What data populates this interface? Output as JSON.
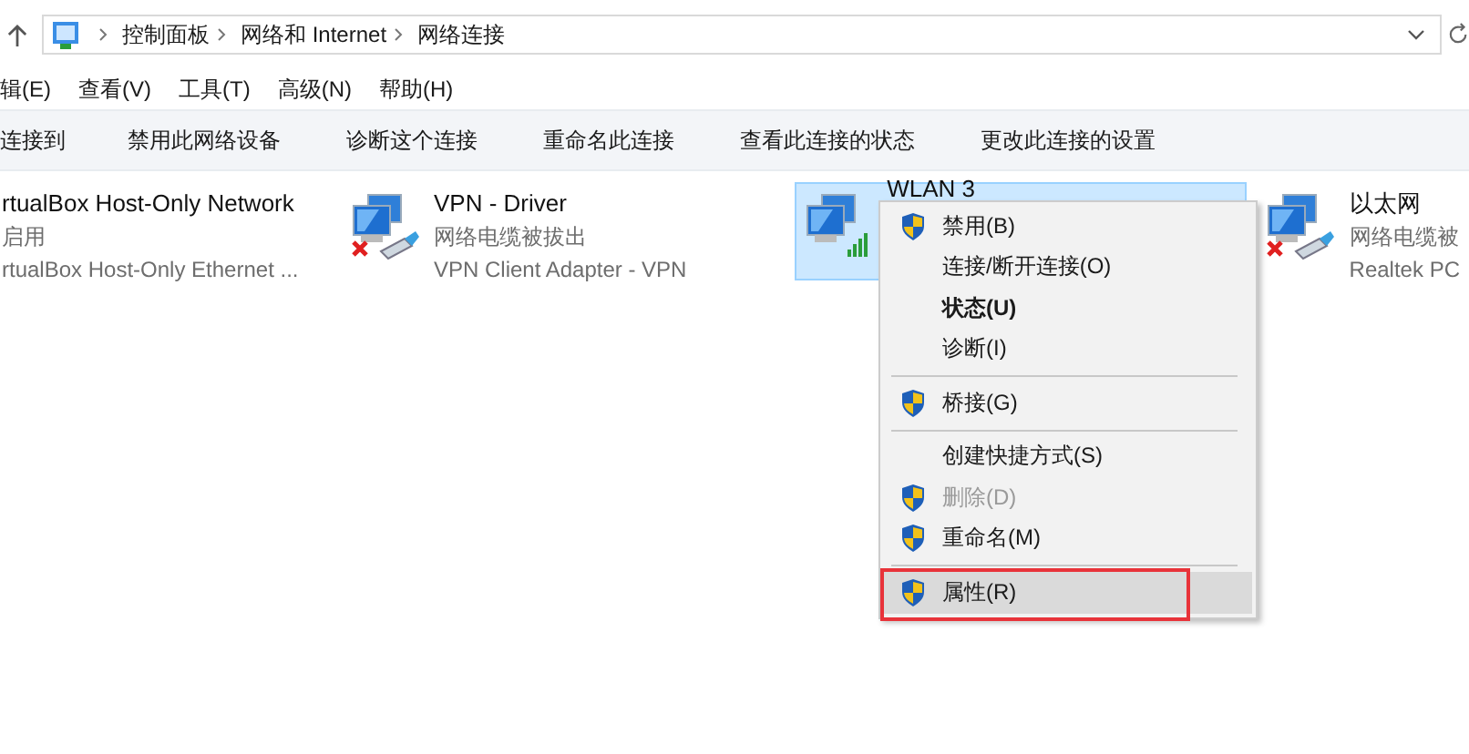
{
  "address_bar": {
    "path": [
      "控制面板",
      "网络和 Internet",
      "网络连接"
    ]
  },
  "menu_bar": [
    "辑(E)",
    "查看(V)",
    "工具(T)",
    "高级(N)",
    "帮助(H)"
  ],
  "command_bar": [
    "连接到",
    "禁用此网络设备",
    "诊断这个连接",
    "重命名此连接",
    "查看此连接的状态",
    "更改此连接的设置"
  ],
  "adapters": [
    {
      "name": "rtualBox Host-Only Network",
      "status": "启用",
      "device": "rtualBox Host-Only Ethernet ...",
      "kind": "hidden",
      "selected": false
    },
    {
      "name": "VPN - Driver",
      "status": "网络电缆被拔出",
      "device": "VPN Client Adapter - VPN",
      "kind": "unplugged",
      "selected": false
    },
    {
      "name": "WLAN 3",
      "kind": "wireless",
      "selected": true
    },
    {
      "name": "以太网",
      "status": "网络电缆被",
      "device": "Realtek PC",
      "kind": "unplugged",
      "selected": false
    }
  ],
  "context_menu": [
    {
      "kind": "item",
      "label": "禁用(B)",
      "shield": true,
      "bold": false,
      "disabled": false,
      "selected": false
    },
    {
      "kind": "item",
      "label": "连接/断开连接(O)",
      "shield": false,
      "bold": false,
      "disabled": false,
      "selected": false
    },
    {
      "kind": "item",
      "label": "状态(U)",
      "shield": false,
      "bold": true,
      "disabled": false,
      "selected": false
    },
    {
      "kind": "item",
      "label": "诊断(I)",
      "shield": false,
      "bold": false,
      "disabled": false,
      "selected": false
    },
    {
      "kind": "separator"
    },
    {
      "kind": "item",
      "label": "桥接(G)",
      "shield": true,
      "bold": false,
      "disabled": false,
      "selected": false
    },
    {
      "kind": "separator"
    },
    {
      "kind": "item",
      "label": "创建快捷方式(S)",
      "shield": false,
      "bold": false,
      "disabled": false,
      "selected": false
    },
    {
      "kind": "item",
      "label": "删除(D)",
      "shield": true,
      "bold": false,
      "disabled": true,
      "selected": false
    },
    {
      "kind": "item",
      "label": "重命名(M)",
      "shield": true,
      "bold": false,
      "disabled": false,
      "selected": false
    },
    {
      "kind": "separator"
    },
    {
      "kind": "item",
      "label": "属性(R)",
      "shield": true,
      "bold": false,
      "disabled": false,
      "selected": true,
      "annotated": true
    }
  ]
}
